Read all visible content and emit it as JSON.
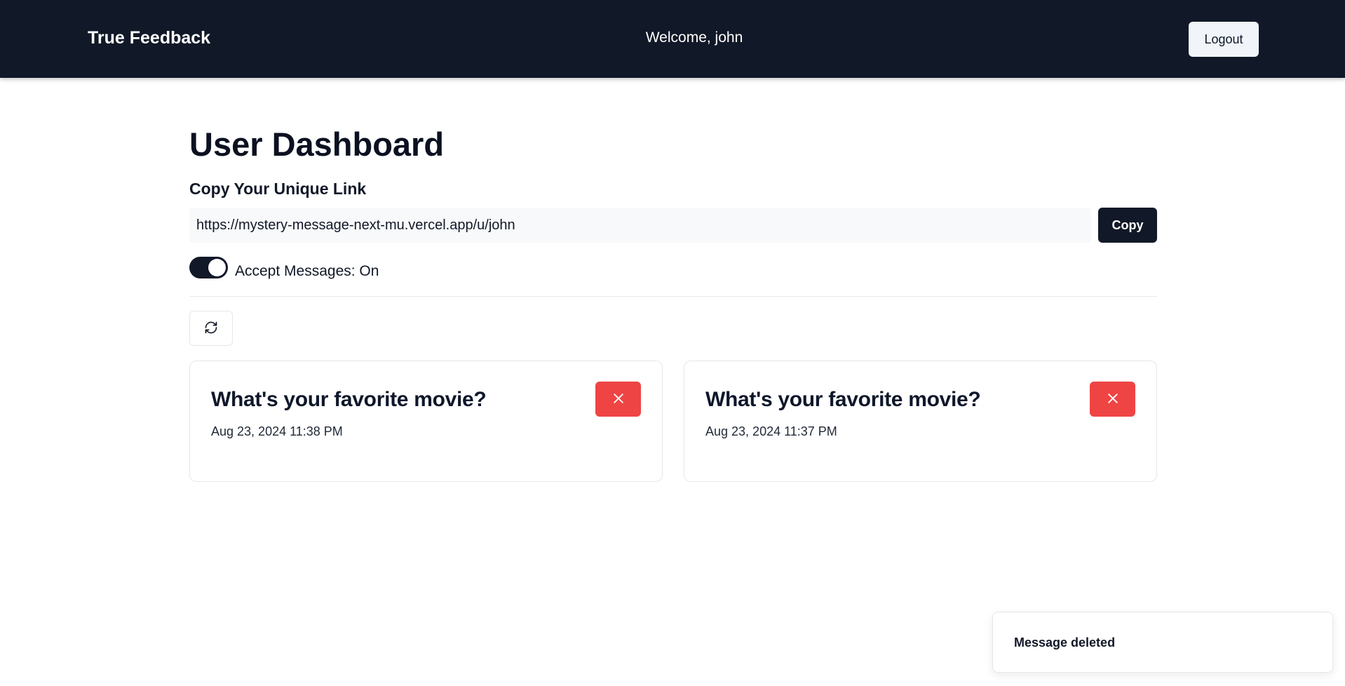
{
  "navbar": {
    "brand": "True Feedback",
    "welcome": "Welcome, john",
    "logout_label": "Logout"
  },
  "dashboard": {
    "title": "User Dashboard",
    "link_section_title": "Copy Your Unique Link",
    "unique_link": "https://mystery-message-next-mu.vercel.app/u/john",
    "copy_label": "Copy",
    "accept_messages_label": "Accept Messages: On",
    "accept_messages_on": true
  },
  "messages": [
    {
      "content": "What's your favorite movie?",
      "date": "Aug 23, 2024 11:38 PM"
    },
    {
      "content": "What's your favorite movie?",
      "date": "Aug 23, 2024 11:37 PM"
    }
  ],
  "toast": {
    "text": "Message deleted"
  },
  "icons": {
    "refresh": "refresh-icon",
    "delete": "close-icon"
  },
  "colors": {
    "navbar_bg": "#111827",
    "primary": "#111827",
    "danger": "#ef4444"
  }
}
